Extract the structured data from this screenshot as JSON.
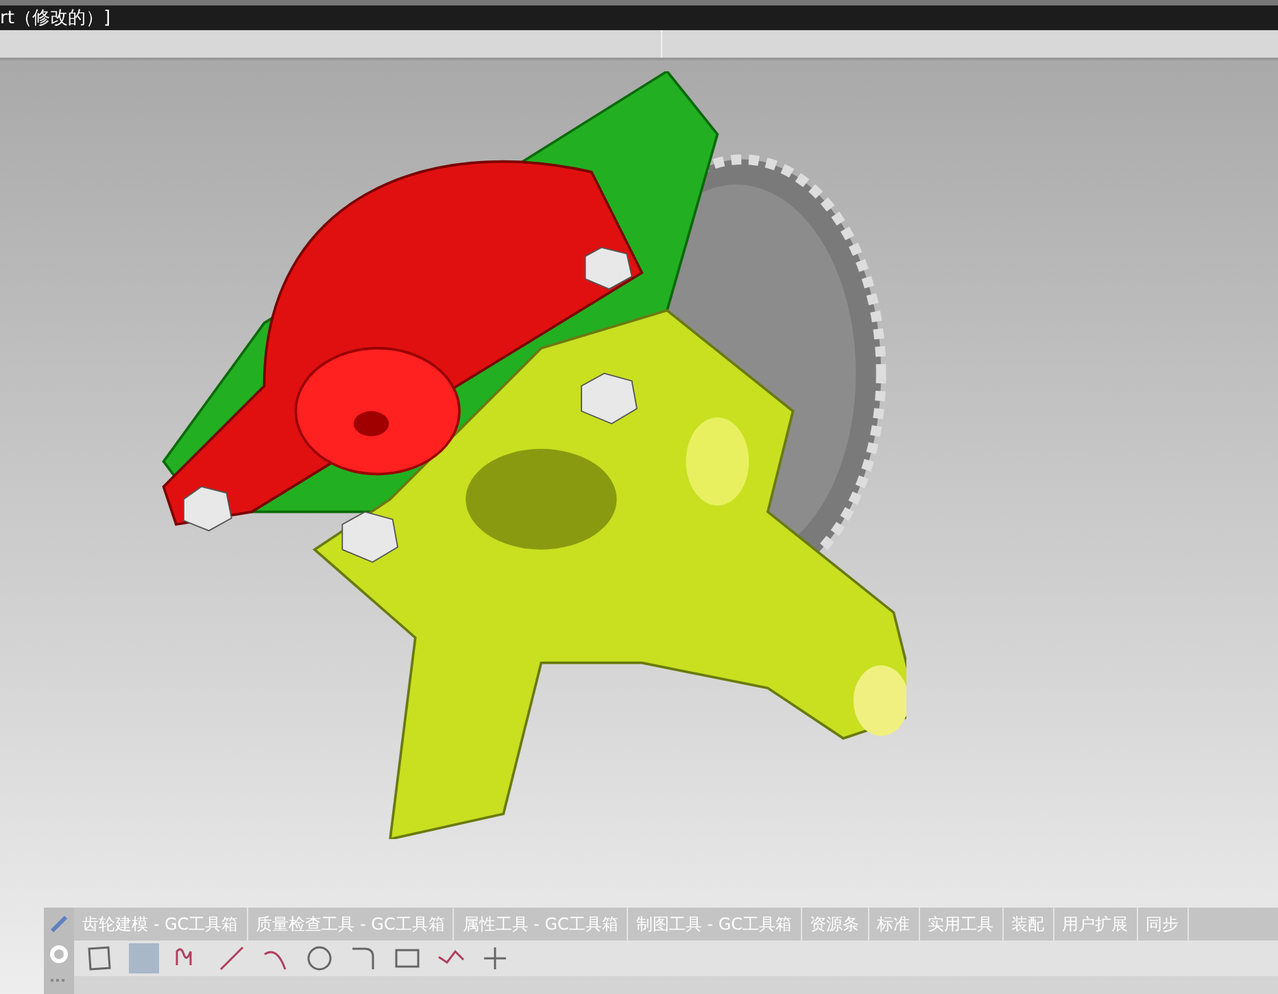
{
  "window": {
    "title": "rt（修改的）]"
  },
  "ribbon_tabs": [
    {
      "label": "齿轮建模 - GC工具箱"
    },
    {
      "label": "质量检查工具 - GC工具箱"
    },
    {
      "label": "属性工具 - GC工具箱"
    },
    {
      "label": "制图工具 - GC工具箱"
    },
    {
      "label": "资源条"
    },
    {
      "label": "标准"
    },
    {
      "label": "实用工具"
    },
    {
      "label": "装配"
    },
    {
      "label": "用户扩展"
    },
    {
      "label": "同步"
    }
  ]
}
